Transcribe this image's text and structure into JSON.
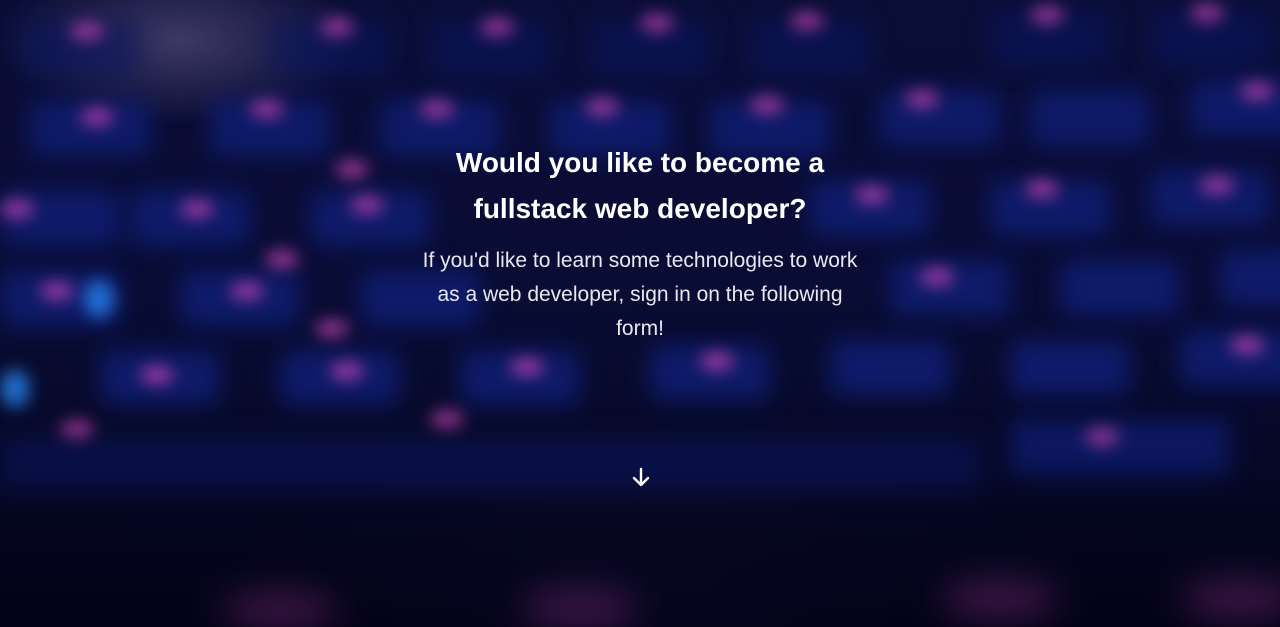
{
  "hero": {
    "title": "Would you like to become a fullstack web developer?",
    "subtitle": "If you'd like to learn some technologies to work as a web developer, sign in on the following form!",
    "scroll_icon": "arrow-down-icon"
  },
  "colors": {
    "background": "#0a0d38",
    "key_blue": "#12248a",
    "key_glow_pink": "#e04cc8",
    "key_glow_blue": "#2a8cff",
    "text": "#ffffff"
  }
}
